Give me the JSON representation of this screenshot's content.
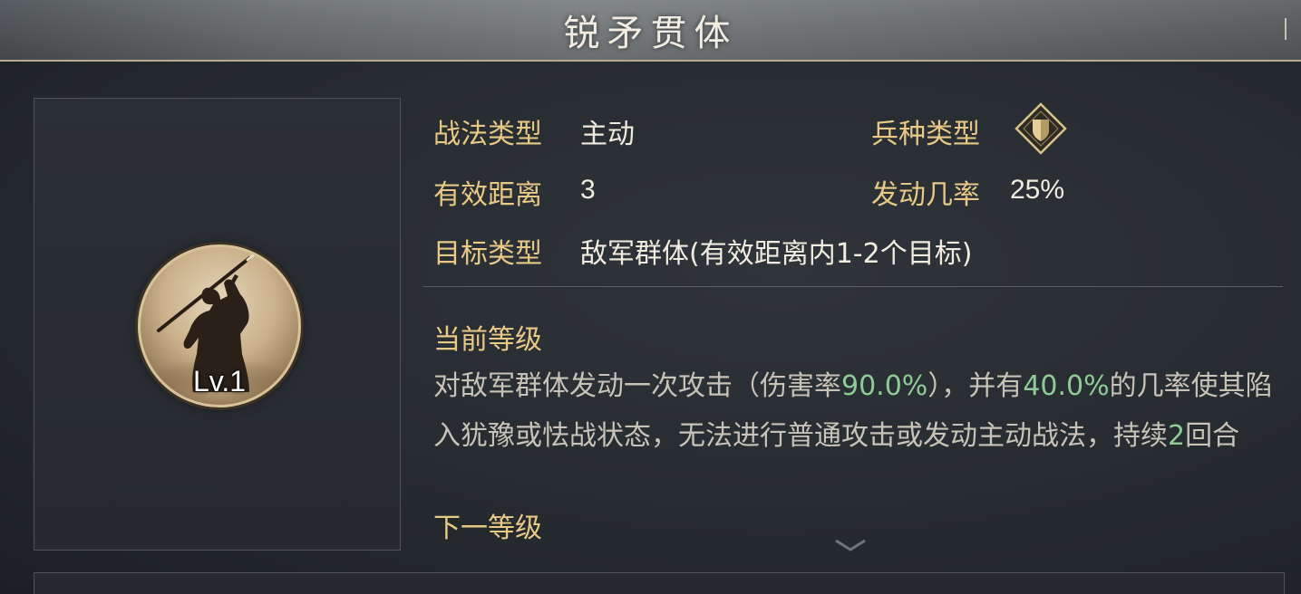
{
  "header": {
    "title": "锐矛贯体"
  },
  "portrait": {
    "level": "Lv.1",
    "icon": "spearman-icon"
  },
  "stats": {
    "type_label": "战法类型",
    "type_value": "主动",
    "range_label": "有效距离",
    "range_value": "3",
    "target_label": "目标类型",
    "target_value": "敌军群体(有效距离内1-2个目标)",
    "unit_label": "兵种类型",
    "unit_icon": "shield-diamond-icon",
    "rate_label": "发动几率",
    "rate_value": "25%"
  },
  "current": {
    "title": "当前等级",
    "t1": "对敌军群体发动一次攻击（伤害率",
    "v1": "90.0%",
    "t2": "），并有",
    "v2": "40.0%",
    "t3": "的几率使其陷入犹豫或怯战状态，无法进行普通攻击或发动主动战法，持续",
    "v3": "2",
    "t4": "回合"
  },
  "next": {
    "title": "下一等级"
  },
  "colors": {
    "label": "#e8ca86",
    "value": "#f1ece0",
    "highlight": "#8ecb95",
    "description": "#c7c3b8"
  }
}
